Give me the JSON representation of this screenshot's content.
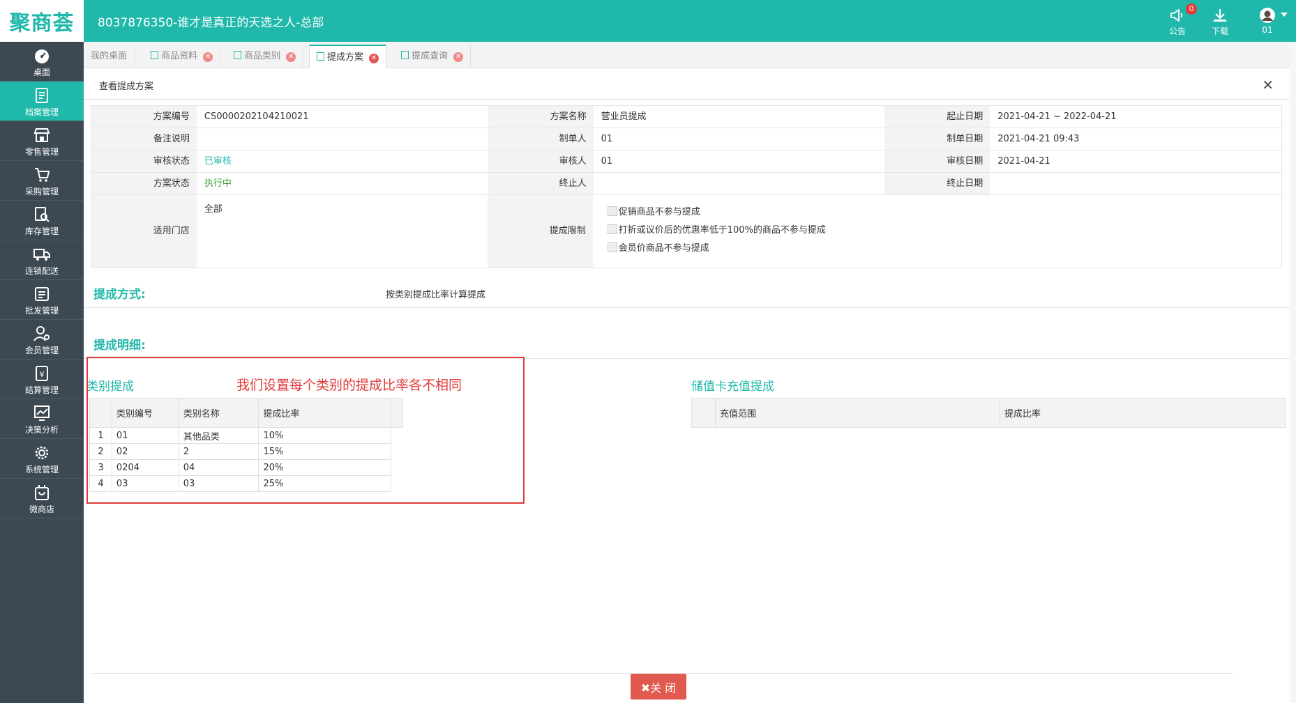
{
  "app": {
    "logo": "聚商荟",
    "title": "8037876350-谁才是真正的天选之人-总部",
    "notice_label": "公告",
    "notice_count": "0",
    "download_label": "下载",
    "user_label": "01"
  },
  "sidebar": {
    "items": [
      {
        "label": "桌面",
        "icon": "dashboard-icon"
      },
      {
        "label": "档案管理",
        "icon": "archive-icon"
      },
      {
        "label": "零售管理",
        "icon": "store-icon"
      },
      {
        "label": "采购管理",
        "icon": "cart-icon"
      },
      {
        "label": "库存管理",
        "icon": "inventory-icon"
      },
      {
        "label": "连锁配送",
        "icon": "truck-icon"
      },
      {
        "label": "批发管理",
        "icon": "wholesale-icon"
      },
      {
        "label": "会员管理",
        "icon": "member-icon"
      },
      {
        "label": "结算管理",
        "icon": "settlement-icon"
      },
      {
        "label": "决策分析",
        "icon": "chart-icon"
      },
      {
        "label": "系统管理",
        "icon": "gear-icon"
      },
      {
        "label": "微商店",
        "icon": "shop-bag-icon"
      }
    ],
    "active_index": 1
  },
  "tabs": [
    {
      "label": "我的桌面"
    },
    {
      "label": "商品资料"
    },
    {
      "label": "商品类别"
    },
    {
      "label": "提成方案"
    },
    {
      "label": "提成查询"
    }
  ],
  "panel": {
    "title": "查看提成方案",
    "close": "×"
  },
  "info": {
    "plan_no_label": "方案编号",
    "plan_no": "CS0000202104210021",
    "plan_name_label": "方案名称",
    "plan_name": "营业员提成",
    "date_range_label": "起止日期",
    "date_range": "2021-04-21 ~ 2022-04-21",
    "remark_label": "备注说明",
    "remark": "",
    "maker_label": "制单人",
    "maker": "01",
    "make_date_label": "制单日期",
    "make_date": "2021-04-21 09:43",
    "audit_status_label": "审核状态",
    "audit_status": "已审核",
    "auditor_label": "审核人",
    "auditor": "01",
    "audit_date_label": "审核日期",
    "audit_date": "2021-04-21",
    "plan_status_label": "方案状态",
    "plan_status": "执行中",
    "terminator_label": "终止人",
    "terminator": "",
    "end_date_label": "终止日期",
    "end_date": "",
    "stores_label": "适用门店",
    "stores": "全部",
    "limit_label": "提成限制",
    "limits": [
      "促销商品不参与提成",
      "打折或议价后的优惠率低于100%的商品不参与提成",
      "会员价商品不参与提成"
    ]
  },
  "method": {
    "heading": "提成方式:",
    "value": "按类别提成比率计算提成"
  },
  "detail": {
    "heading": "提成明细:",
    "category_title": "类别提成",
    "category_headers": [
      "类别编号",
      "类别名称",
      "提成比率"
    ],
    "category_rows": [
      {
        "idx": "1",
        "code": "01",
        "name": "其他品类",
        "rate": "10%"
      },
      {
        "idx": "2",
        "code": "02",
        "name": "2",
        "rate": "15%"
      },
      {
        "idx": "3",
        "code": "0204",
        "name": "04",
        "rate": "20%"
      },
      {
        "idx": "4",
        "code": "03",
        "name": "03",
        "rate": "25%"
      }
    ],
    "card_title": "储值卡充值提成",
    "card_headers": [
      "充值范围",
      "提成比率"
    ]
  },
  "annotation": "我们设置每个类别的提成比率各不相同",
  "footer": {
    "close_label": "✖关 闭"
  },
  "colors": {
    "brand": "#1fb8aa",
    "sidebar": "#3c4852",
    "annotation": "#e23a3a",
    "close_button": "#e05a4f"
  }
}
